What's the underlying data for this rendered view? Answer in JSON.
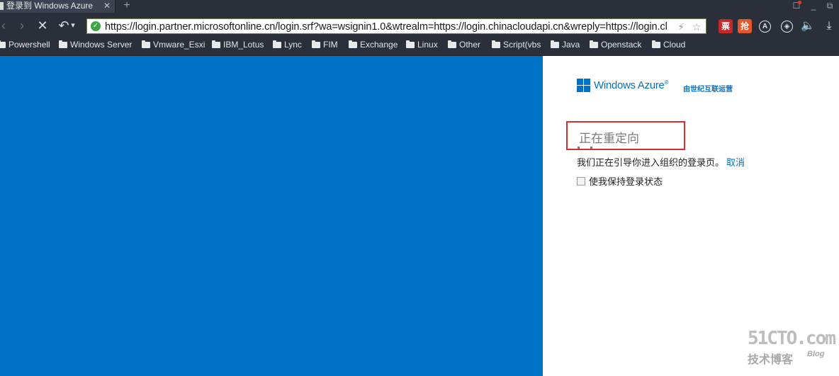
{
  "browser": {
    "tab": {
      "title": "登录到 Windows Azure",
      "close_glyph": "✕"
    },
    "new_tab_glyph": "+",
    "window_controls": [
      "☐",
      "_",
      "⧉"
    ],
    "url": "https://login.partner.microsoftonline.cn/login.srf?wa=wsignin1.0&wtrealm=https://login.chinacloudapi.cn&wreply=https://login.cl",
    "nav": {
      "back": "‹",
      "forward": "›",
      "stop": "✕",
      "undo": "↶",
      "undo_menu": "▾"
    },
    "address_actions": [
      "⚡",
      "☆"
    ],
    "extensions": [
      {
        "label": "票",
        "icon": "ticket-extension-icon",
        "color": "#c62828"
      },
      {
        "label": "抢",
        "icon": "grab-extension-icon",
        "color": "#e2582b"
      },
      {
        "label": "A",
        "icon": "adblock-icon"
      },
      {
        "label": "◈",
        "icon": "compass-icon"
      },
      {
        "label": "🔈",
        "icon": "speaker-icon"
      },
      {
        "label": "⤓",
        "icon": "download-icon"
      }
    ],
    "bookmarks": [
      "Powershell",
      "Windows Server",
      "Vmware_Esxi",
      "IBM_Lotus",
      "Lync",
      "FIM",
      "Exchange",
      "Linux",
      "Other",
      "Script(vbs",
      "Java",
      "Openstack",
      "Cloud"
    ]
  },
  "page": {
    "logo_text": "Windows Azure",
    "logo_registered": "®",
    "logo_sub": "由世纪互联运营",
    "redirect_title": "正在重定向",
    "redirect_message": "我们正在引导你进入组织的登录页。",
    "cancel_label": "取消",
    "keep_signed_in_label": "使我保持登录状态",
    "accent_color": "#0072c6"
  },
  "watermark": {
    "main": "51CTO.com",
    "sub": "技术博客",
    "blog": "Blog"
  }
}
